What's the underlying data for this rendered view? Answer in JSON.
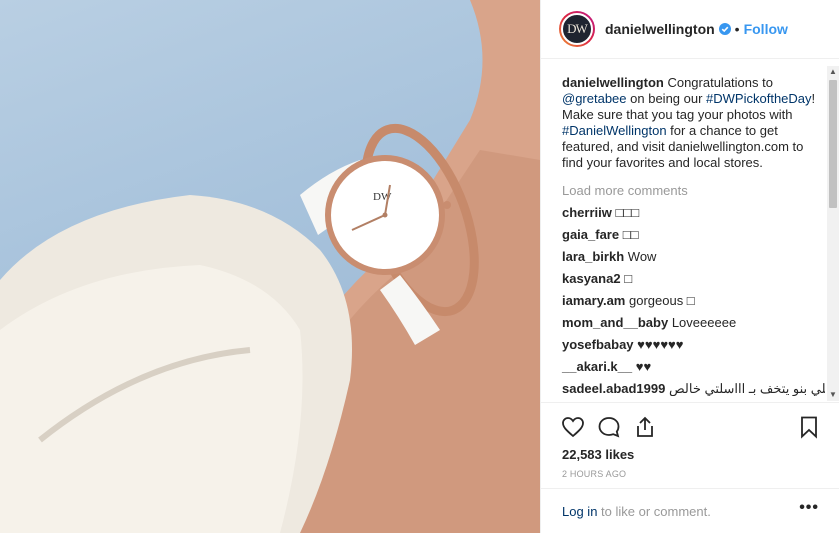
{
  "header": {
    "avatar_text": "DW",
    "username": "danielwellington",
    "separator": "•",
    "follow_label": "Follow"
  },
  "caption": {
    "username": "danielwellington",
    "part1": " Congratulations to ",
    "mention": "@gretabee",
    "part2": " on being our ",
    "hashtag1": "#DWPickoftheDay",
    "part3": "! Make sure that you tag your photos with ",
    "hashtag2": "#DanielWellington",
    "part4": " for a chance to get featured, and visit danielwellington.com to find your favorites and local stores."
  },
  "load_more": "Load more comments",
  "comments": [
    {
      "user": "cherriiw",
      "text": "□□□"
    },
    {
      "user": "gaia_fare",
      "text": "□□"
    },
    {
      "user": "lara_birkh",
      "text": "Wow"
    },
    {
      "user": "kasyana2",
      "text": "□"
    },
    {
      "user": "iamary.am",
      "text": "gorgeous □"
    },
    {
      "user": "mom_and__baby",
      "text": "Loveeeeee"
    },
    {
      "user": "yosefbabay",
      "text": "♥♥♥♥♥♥"
    },
    {
      "user": "__akari.k__",
      "text": "♥♥"
    },
    {
      "user": "sadeel.abad1999",
      "text": "اللي بنو يتخف بـ اااسلتي خالص"
    }
  ],
  "likes": "22,583 likes",
  "timestamp": "2 HOURS AGO",
  "footer": {
    "login": "Log in",
    "rest": " to like or comment.",
    "more": "•••"
  },
  "icons": {
    "like": "heart-icon",
    "comment": "comment-icon",
    "share": "share-icon",
    "save": "bookmark-icon",
    "verified": "verified-badge-icon"
  },
  "colors": {
    "link": "#003569",
    "follow": "#3897f0",
    "muted": "#999999"
  }
}
